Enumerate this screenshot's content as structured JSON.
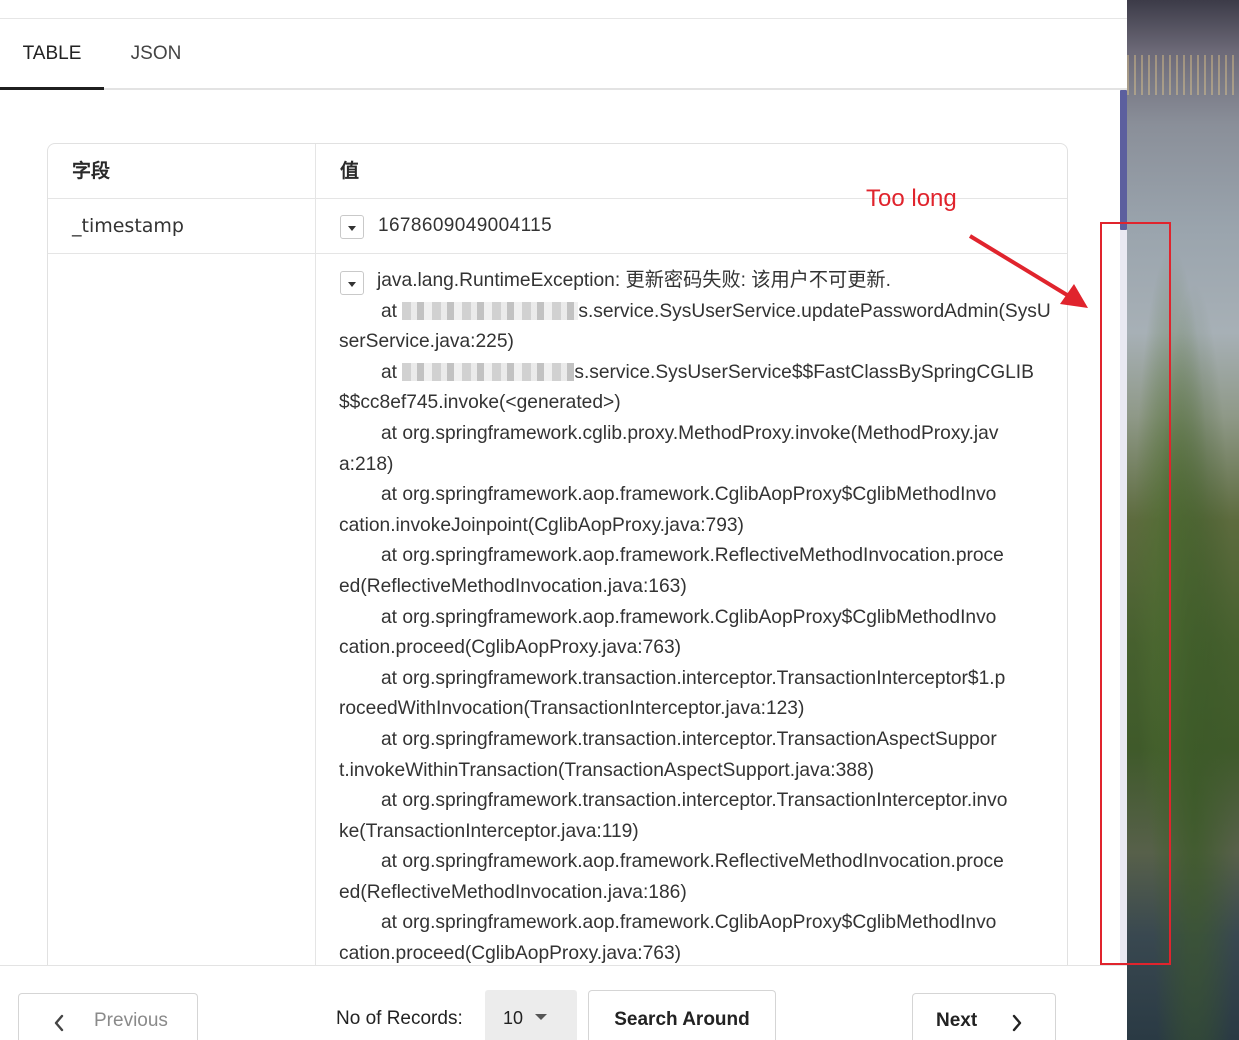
{
  "tabs": [
    {
      "label": "TABLE",
      "active": true
    },
    {
      "label": "JSON",
      "active": false
    }
  ],
  "table": {
    "headers": {
      "field": "字段",
      "value": "值"
    },
    "rows": [
      {
        "field": "_timestamp",
        "value": "1678609049004115"
      },
      {
        "field": "",
        "value_lines": [
          "java.lang.RuntimeException: 更新密码失败: 该用户不可更新.",
          "at ",
          "s.service.SysUserService.updatePasswordAdmin(SysU",
          "serService.java:225)",
          "at ",
          "s.service.SysUserService$$FastClassBySpringCGLIB",
          "$$cc8ef745.invoke(<generated>)",
          "at org.springframework.cglib.proxy.MethodProxy.invoke(MethodProxy.jav",
          "a:218)",
          "at org.springframework.aop.framework.CglibAopProxy$CglibMethodInvo",
          "cation.invokeJoinpoint(CglibAopProxy.java:793)",
          "at org.springframework.aop.framework.ReflectiveMethodInvocation.proce",
          "ed(ReflectiveMethodInvocation.java:163)",
          "at org.springframework.aop.framework.CglibAopProxy$CglibMethodInvo",
          "cation.proceed(CglibAopProxy.java:763)",
          "at org.springframework.transaction.interceptor.TransactionInterceptor$1.p",
          "roceedWithInvocation(TransactionInterceptor.java:123)",
          "at org.springframework.transaction.interceptor.TransactionAspectSuppor",
          "t.invokeWithinTransaction(TransactionAspectSupport.java:388)",
          "at org.springframework.transaction.interceptor.TransactionInterceptor.invo",
          "ke(TransactionInterceptor.java:119)",
          "at org.springframework.aop.framework.ReflectiveMethodInvocation.proce",
          "ed(ReflectiveMethodInvocation.java:186)",
          "at org.springframework.aop.framework.CglibAopProxy$CglibMethodInvo",
          "cation.proceed(CglibAopProxy.java:763)"
        ]
      }
    ]
  },
  "footer": {
    "previous_label": "Previous",
    "records_label": "No of Records:",
    "records_value": "10",
    "search_around_label": "Search Around",
    "next_label": "Next"
  },
  "annotation": {
    "text": "Too long",
    "color": "#e0242d"
  },
  "icons": {
    "prev": "chevron-left-icon",
    "next": "chevron-right-icon",
    "expand": "caret-down-icon",
    "records_dropdown": "caret-down-icon"
  },
  "colors": {
    "scrollbar_thumb": "#5c5f9e",
    "active_tab_underline": "#1f1f1f"
  }
}
